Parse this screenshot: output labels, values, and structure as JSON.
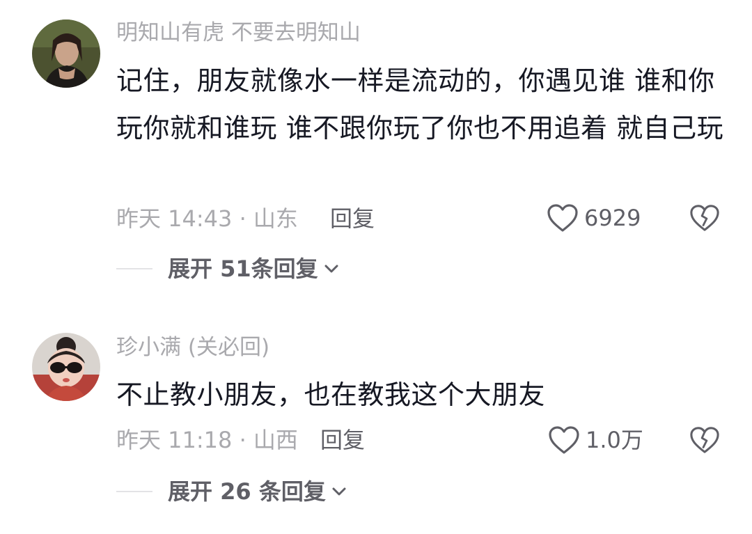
{
  "comments": [
    {
      "username": "明知山有虎 不要去明知山",
      "text": "记住，朋友就像水一样是流动的，你遇见谁 谁和你玩你就和谁玩 谁不跟你玩了你也不用追着 就自己玩",
      "meta": "昨天 14:43 · 山东",
      "reply_label": "回复",
      "like_count": "6929",
      "expand_label": "展开 51条回复"
    },
    {
      "username": "珍小满 (关必回)",
      "text": "不止教小朋友，也在教我这个大朋友",
      "meta": "昨天 11:18 · 山西",
      "reply_label": "回复",
      "like_count": "1.0万",
      "expand_label": "展开 26 条回复"
    }
  ],
  "icons": {
    "like": "heart-outline-icon",
    "dislike": "broken-heart-icon",
    "expand": "chevron-down-icon"
  },
  "colors": {
    "text": "#161823",
    "secondary": "#a9a9ad",
    "action": "#5f5f66"
  }
}
